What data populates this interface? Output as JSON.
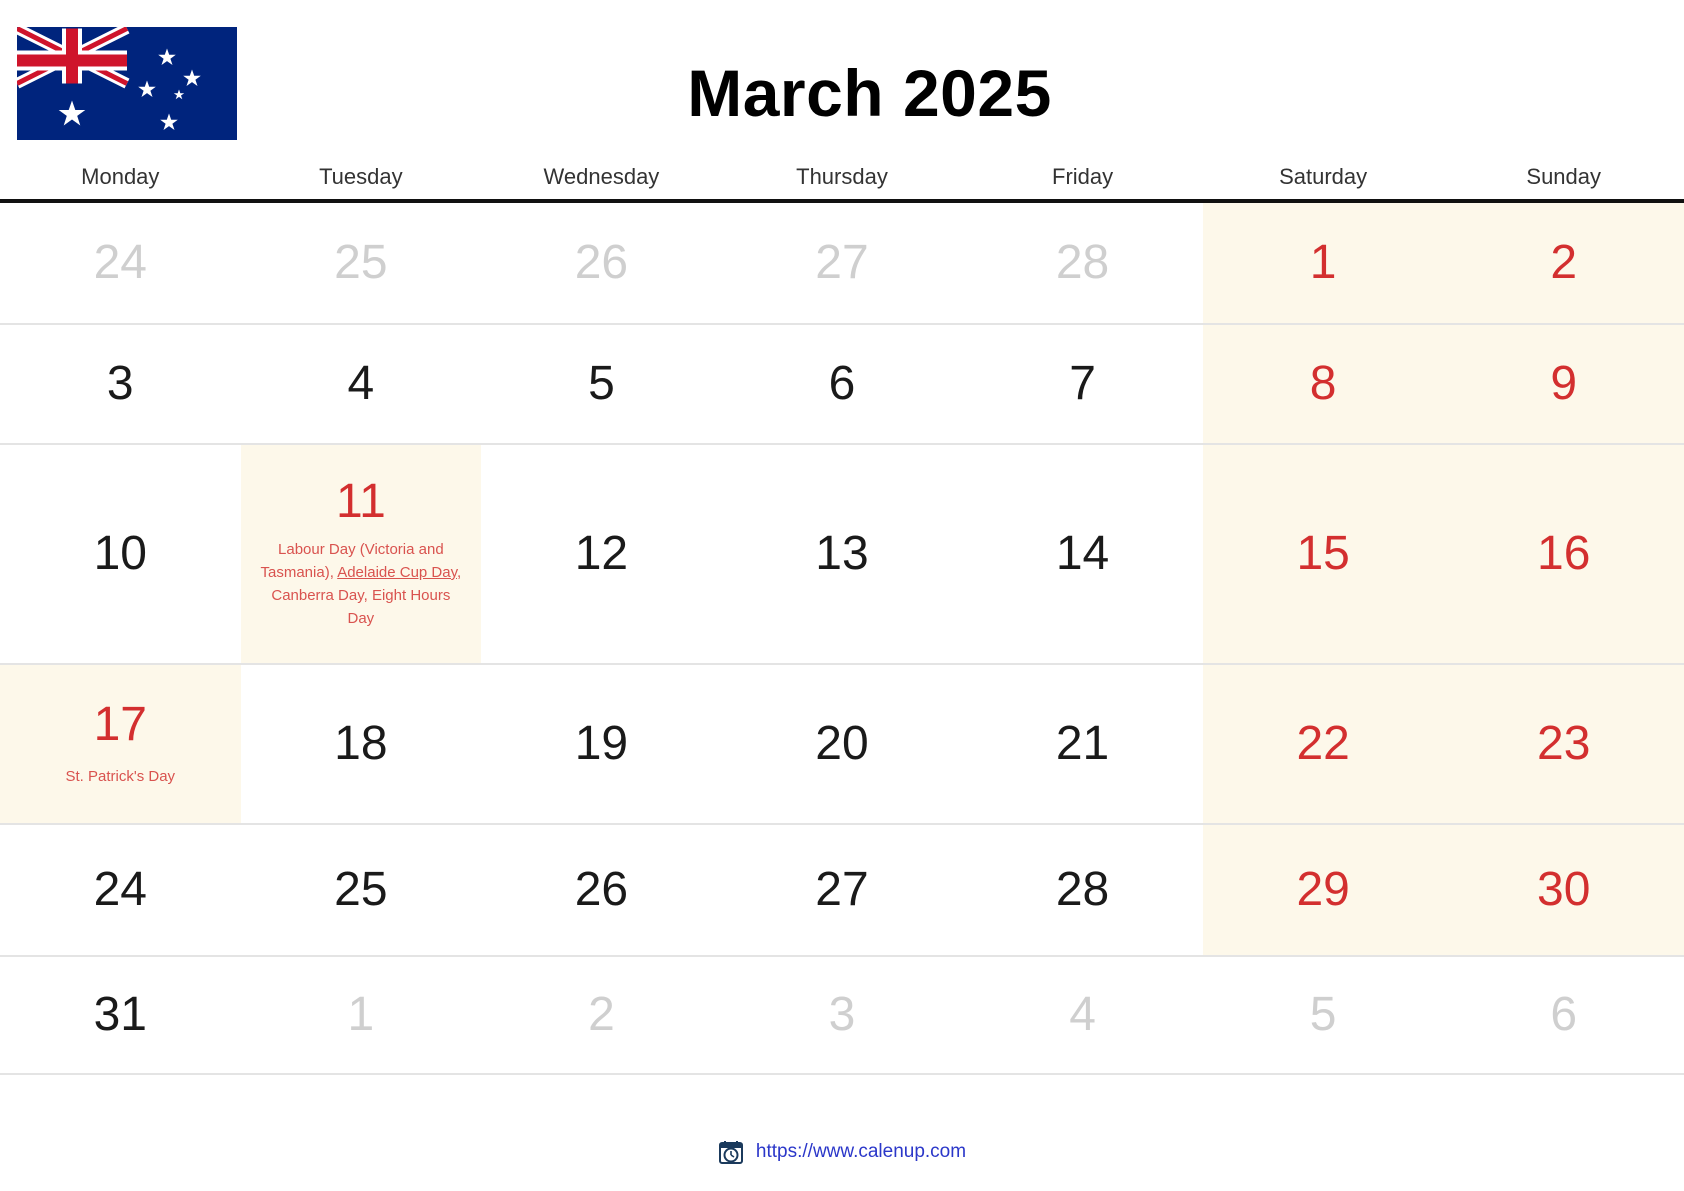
{
  "header": {
    "title": "March 2025",
    "flag_icon": "australia-flag-icon",
    "flag_colors": {
      "navy": "#00247D",
      "red": "#CF142B",
      "white": "#FFFFFF"
    }
  },
  "weekdays": [
    "Monday",
    "Tuesday",
    "Wednesday",
    "Thursday",
    "Friday",
    "Saturday",
    "Sunday"
  ],
  "colors": {
    "weekend_background": "#FDF8EA",
    "holiday_text": "#D9534F",
    "weekend_number": "#D32F2F",
    "other_month_number": "#CFCFCF",
    "day_number": "#1A1A1A",
    "link": "#2B37C9",
    "header_rule": "#111111",
    "grid_line": "#E4E4E4"
  },
  "weeks": [
    {
      "row": 1,
      "days": [
        {
          "num": "24",
          "style": "muted",
          "weekend": false,
          "events": []
        },
        {
          "num": "25",
          "style": "muted",
          "weekend": false,
          "events": []
        },
        {
          "num": "26",
          "style": "muted",
          "weekend": false,
          "events": []
        },
        {
          "num": "27",
          "style": "muted",
          "weekend": false,
          "events": []
        },
        {
          "num": "28",
          "style": "muted",
          "weekend": false,
          "events": []
        },
        {
          "num": "1",
          "style": "red",
          "weekend": true,
          "events": []
        },
        {
          "num": "2",
          "style": "red",
          "weekend": true,
          "events": []
        }
      ]
    },
    {
      "row": 2,
      "days": [
        {
          "num": "3",
          "style": "normal",
          "weekend": false,
          "events": []
        },
        {
          "num": "4",
          "style": "normal",
          "weekend": false,
          "events": []
        },
        {
          "num": "5",
          "style": "normal",
          "weekend": false,
          "events": []
        },
        {
          "num": "6",
          "style": "normal",
          "weekend": false,
          "events": []
        },
        {
          "num": "7",
          "style": "normal",
          "weekend": false,
          "events": []
        },
        {
          "num": "8",
          "style": "red",
          "weekend": true,
          "events": []
        },
        {
          "num": "9",
          "style": "red",
          "weekend": true,
          "events": []
        }
      ]
    },
    {
      "row": 3,
      "days": [
        {
          "num": "10",
          "style": "normal",
          "weekend": false,
          "events": []
        },
        {
          "num": "11",
          "style": "red",
          "weekend": false,
          "holiday": true,
          "events_text": "Labour Day (Victoria and Tasmania), Adelaide Cup Day, Canberra Day, Eight Hours Day",
          "events_parts": [
            {
              "text": "Labour Day (Victoria and Tasmania), ",
              "link": false
            },
            {
              "text": "Adelaide Cup Day",
              "link": true
            },
            {
              "text": ", Canberra Day, Eight Hours Day",
              "link": false
            }
          ]
        },
        {
          "num": "12",
          "style": "normal",
          "weekend": false,
          "events": []
        },
        {
          "num": "13",
          "style": "normal",
          "weekend": false,
          "events": []
        },
        {
          "num": "14",
          "style": "normal",
          "weekend": false,
          "events": []
        },
        {
          "num": "15",
          "style": "red",
          "weekend": true,
          "events": []
        },
        {
          "num": "16",
          "style": "red",
          "weekend": true,
          "events": []
        }
      ]
    },
    {
      "row": 4,
      "days": [
        {
          "num": "17",
          "style": "red",
          "weekend": false,
          "holiday": true,
          "events_text": "St. Patrick's Day",
          "events_parts": [
            {
              "text": "St. Patrick's Day",
              "link": false
            }
          ]
        },
        {
          "num": "18",
          "style": "normal",
          "weekend": false,
          "events": []
        },
        {
          "num": "19",
          "style": "normal",
          "weekend": false,
          "events": []
        },
        {
          "num": "20",
          "style": "normal",
          "weekend": false,
          "events": []
        },
        {
          "num": "21",
          "style": "normal",
          "weekend": false,
          "events": []
        },
        {
          "num": "22",
          "style": "red",
          "weekend": true,
          "events": []
        },
        {
          "num": "23",
          "style": "red",
          "weekend": true,
          "events": []
        }
      ]
    },
    {
      "row": 5,
      "days": [
        {
          "num": "24",
          "style": "normal",
          "weekend": false,
          "events": []
        },
        {
          "num": "25",
          "style": "normal",
          "weekend": false,
          "events": []
        },
        {
          "num": "26",
          "style": "normal",
          "weekend": false,
          "events": []
        },
        {
          "num": "27",
          "style": "normal",
          "weekend": false,
          "events": []
        },
        {
          "num": "28",
          "style": "normal",
          "weekend": false,
          "events": []
        },
        {
          "num": "29",
          "style": "red",
          "weekend": true,
          "events": []
        },
        {
          "num": "30",
          "style": "red",
          "weekend": true,
          "events": []
        }
      ]
    },
    {
      "row": 6,
      "days": [
        {
          "num": "31",
          "style": "normal",
          "weekend": false,
          "events": []
        },
        {
          "num": "1",
          "style": "muted",
          "weekend": false,
          "events": []
        },
        {
          "num": "2",
          "style": "muted",
          "weekend": false,
          "events": []
        },
        {
          "num": "3",
          "style": "muted",
          "weekend": false,
          "events": []
        },
        {
          "num": "4",
          "style": "muted",
          "weekend": false,
          "events": []
        },
        {
          "num": "5",
          "style": "muted",
          "weekend": false,
          "events": []
        },
        {
          "num": "6",
          "style": "muted",
          "weekend": false,
          "events": []
        }
      ]
    }
  ],
  "footer": {
    "icon": "calendar-clock-icon",
    "url": "https://www.calenup.com"
  }
}
